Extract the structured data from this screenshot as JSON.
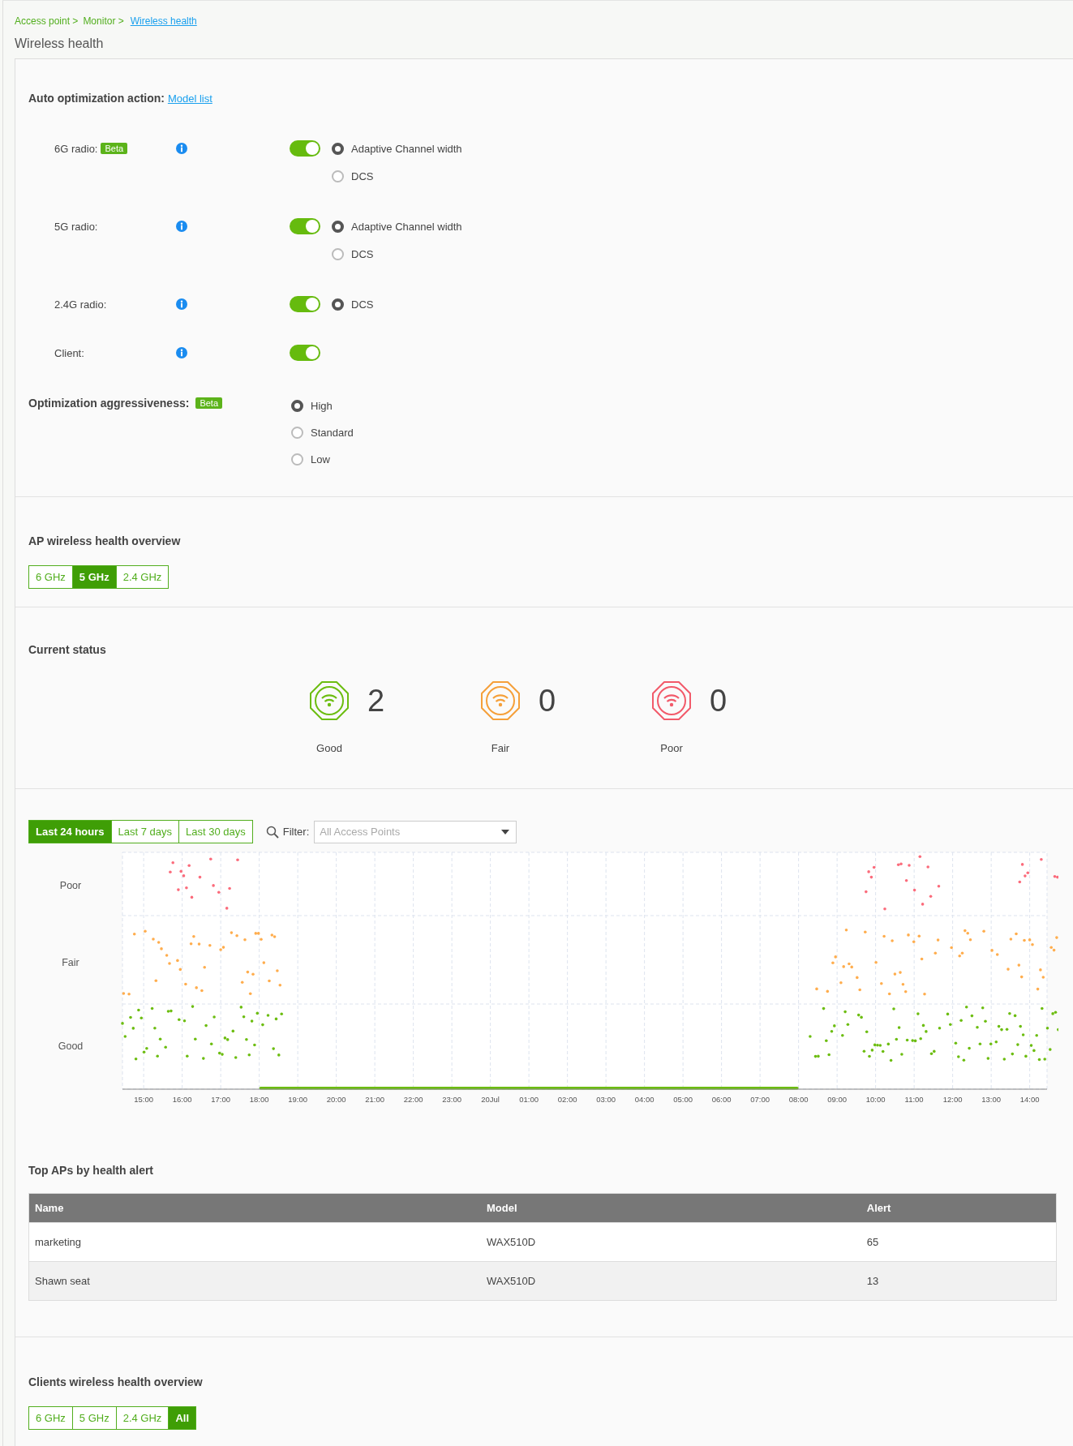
{
  "breadcrumb": [
    {
      "text": "Access point >",
      "link": false
    },
    {
      "text": "Monitor >",
      "link": false
    },
    {
      "text": "Wireless health",
      "link": true
    }
  ],
  "page_title": "Wireless health",
  "auto_optimization": {
    "title": "Auto optimization action:",
    "link": "Model list",
    "rows": [
      {
        "label": "6G radio:",
        "badge": "Beta",
        "on": true,
        "options": [
          {
            "label": "Adaptive Channel width",
            "selected": true
          },
          {
            "label": "DCS",
            "selected": false
          }
        ]
      },
      {
        "label": "5G radio:",
        "on": true,
        "options": [
          {
            "label": "Adaptive Channel width",
            "selected": true
          },
          {
            "label": "DCS",
            "selected": false
          }
        ]
      },
      {
        "label": "2.4G radio:",
        "on": true,
        "options": [
          {
            "label": "DCS",
            "selected": true
          }
        ]
      },
      {
        "label": "Client:",
        "on": true
      }
    ]
  },
  "aggressiveness": {
    "title": "Optimization aggressiveness:",
    "badge": "Beta",
    "options": [
      {
        "label": "High",
        "selected": true
      },
      {
        "label": "Standard",
        "selected": false
      },
      {
        "label": "Low",
        "selected": false
      }
    ]
  },
  "ap_overview": {
    "title": "AP wireless health overview",
    "tabs": [
      {
        "label": "6 GHz",
        "selected": false
      },
      {
        "label": "5 GHz",
        "selected": true
      },
      {
        "label": "2.4 GHz",
        "selected": false
      }
    ]
  },
  "current_status": {
    "title": "Current status",
    "items": [
      {
        "label": "Good",
        "count": "2",
        "color": "#6cbd10"
      },
      {
        "label": "Fair",
        "count": "0",
        "color": "#f5a03a"
      },
      {
        "label": "Poor",
        "count": "0",
        "color": "#f25a6a"
      }
    ]
  },
  "history": {
    "ranges": [
      {
        "label": "Last 24 hours",
        "selected": true
      },
      {
        "label": "Last 7 days",
        "selected": false
      },
      {
        "label": "Last 30 days",
        "selected": false
      }
    ],
    "filter": {
      "label": "Filter:",
      "placeholder": "All Access Points"
    },
    "chart": {
      "y_labels": [
        "Poor",
        "Fair",
        "Good"
      ],
      "x_labels": [
        "15:00",
        "16:00",
        "17:00",
        "18:00",
        "19:00",
        "20:00",
        "21:00",
        "22:00",
        "23:00",
        "20Jul",
        "01:00",
        "02:00",
        "03:00",
        "04:00",
        "05:00",
        "06:00",
        "07:00",
        "08:00",
        "09:00",
        "10:00",
        "11:00",
        "12:00",
        "13:00",
        "14:00"
      ]
    }
  },
  "top_aps": {
    "title": "Top APs by health alert",
    "columns": [
      "Name",
      "Model",
      "Alert"
    ],
    "rows": [
      [
        "marketing",
        "WAX510D",
        "65"
      ],
      [
        "Shawn seat",
        "WAX510D",
        "13"
      ]
    ]
  },
  "clients_overview": {
    "title": "Clients wireless health overview",
    "tabs": [
      {
        "label": "6 GHz",
        "selected": false
      },
      {
        "label": "5 GHz",
        "selected": false
      },
      {
        "label": "2.4 GHz",
        "selected": false
      },
      {
        "label": "All",
        "selected": true
      }
    ]
  }
}
